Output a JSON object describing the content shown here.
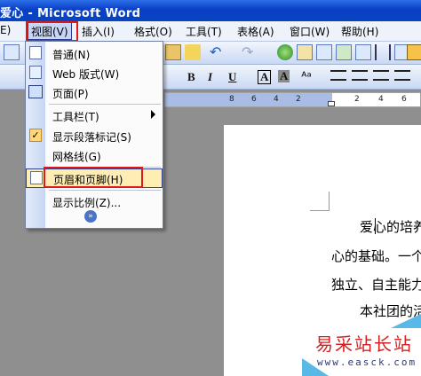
{
  "window": {
    "title": "爱心 - Microsoft Word"
  },
  "menubar": {
    "items": [
      {
        "label": "E)"
      },
      {
        "label": "视图(V)"
      },
      {
        "label": "插入(I)"
      },
      {
        "label": "格式(O)"
      },
      {
        "label": "工具(T)"
      },
      {
        "label": "表格(A)"
      },
      {
        "label": "窗口(W)"
      },
      {
        "label": "帮助(H)"
      }
    ]
  },
  "view_menu": {
    "items": [
      {
        "label": "普通(N)",
        "icon": "normal-view-icon"
      },
      {
        "label": "Web 版式(W)",
        "icon": "web-layout-icon"
      },
      {
        "label": "页面(P)",
        "icon": "print-layout-icon"
      },
      {
        "label": "工具栏(T)",
        "has_submenu": true
      },
      {
        "label": "显示段落标记(S)",
        "checked": true,
        "icon": "check-icon"
      },
      {
        "label": "网格线(G)"
      },
      {
        "label": "页眉和页脚(H)",
        "icon": "header-footer-icon",
        "highlighted": true
      },
      {
        "label": "显示比例(Z)..."
      }
    ],
    "expand_glyph": "»"
  },
  "formatting": {
    "bold": "B",
    "italic": "I",
    "underline": "U",
    "char_border": "A",
    "char_shading": "A"
  },
  "ruler": {
    "numbers": [
      "8",
      "6",
      "4",
      "2",
      "2",
      "4",
      "6"
    ]
  },
  "document": {
    "lines": [
      "爱心的培养",
      "心的基础。一个",
      "独立、自主能力",
      "本社团的活"
    ]
  },
  "watermark": {
    "text": "易采站长站",
    "url": "www.easck.com"
  },
  "colors": {
    "titlebar": "#0a3fc5",
    "highlight": "#ffeeb4",
    "red_annotation": "#e01818",
    "watermark": "#d42020"
  }
}
